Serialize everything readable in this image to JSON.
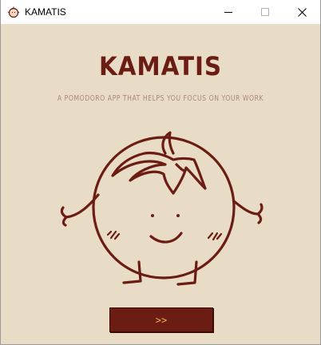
{
  "window": {
    "title": "KAMATIS",
    "icon": "tomato-app-icon",
    "controls": [
      "minimize-icon",
      "maximize-icon",
      "close-icon"
    ]
  },
  "main": {
    "heading": "KAMATIS",
    "subtitle": "A POMODORO APP THAT HELPS YOU FOCUS ON YOUR WORK",
    "illustration": "tomato-mascot",
    "next_button_label": ">>"
  },
  "colors": {
    "background": "#e9dcc6",
    "brand": "#6b1c13",
    "subtitle": "#a98877",
    "button_text": "#f4b24a"
  }
}
